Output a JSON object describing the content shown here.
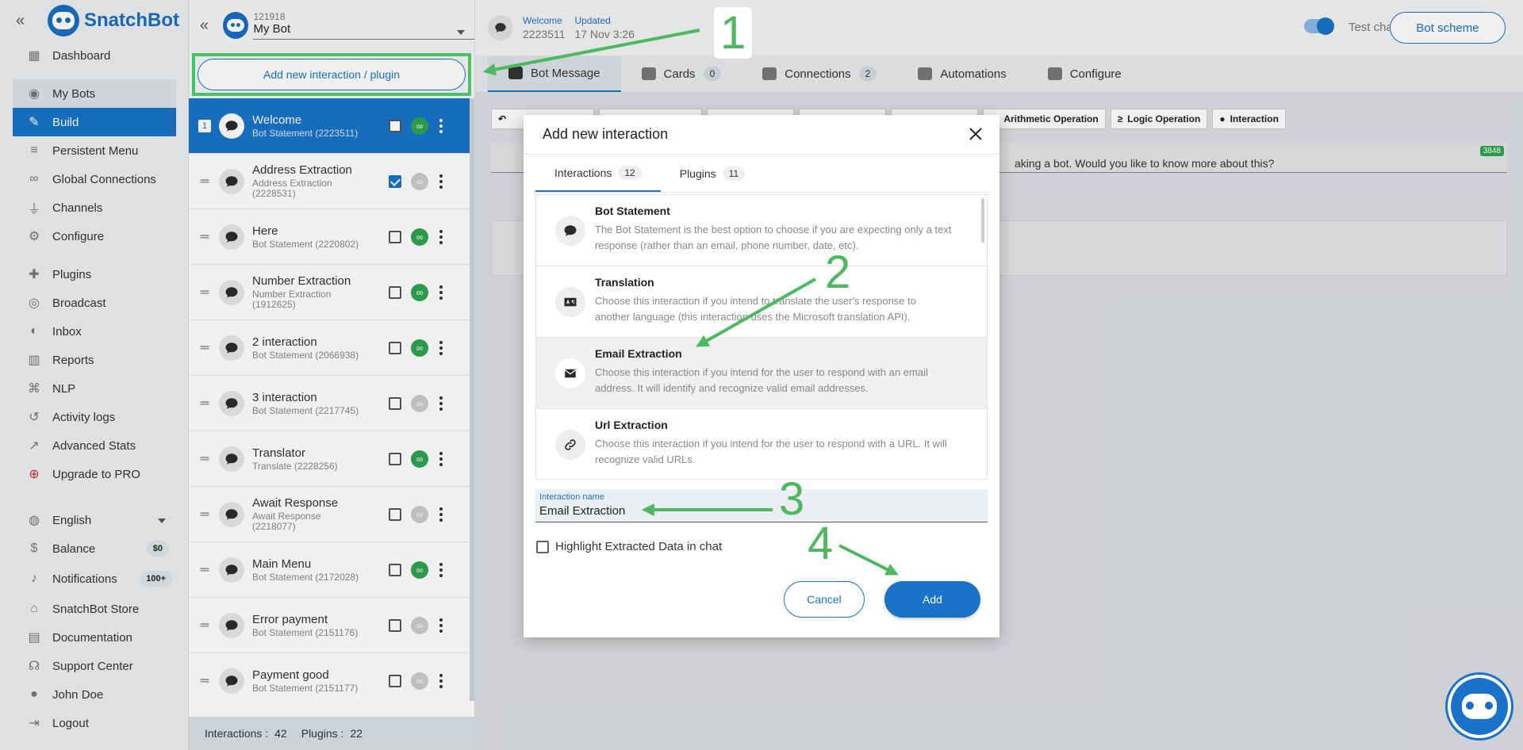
{
  "app": {
    "name": "SnatchBot"
  },
  "sidebar": {
    "items": [
      {
        "label": "Dashboard",
        "icon": "dashboard-icon"
      },
      {
        "label": "My Bots",
        "icon": "robot-icon"
      },
      {
        "label": "Build",
        "icon": "edit-icon"
      },
      {
        "label": "Persistent Menu",
        "icon": "menu-icon"
      },
      {
        "label": "Global Connections",
        "icon": "link-icon"
      },
      {
        "label": "Channels",
        "icon": "plug-icon"
      },
      {
        "label": "Configure",
        "icon": "gear-icon"
      },
      {
        "label": "Plugins",
        "icon": "puzzle-icon"
      },
      {
        "label": "Broadcast",
        "icon": "broadcast-icon"
      },
      {
        "label": "Inbox",
        "icon": "chat-icon"
      },
      {
        "label": "Reports",
        "icon": "bar-chart-icon"
      },
      {
        "label": "NLP",
        "icon": "nlp-icon"
      },
      {
        "label": "Activity logs",
        "icon": "history-icon"
      },
      {
        "label": "Advanced Stats",
        "icon": "line-chart-icon"
      },
      {
        "label": "Upgrade to PRO",
        "icon": "plus-circle-icon"
      }
    ],
    "language": "English",
    "balance_label": "Balance",
    "balance_value": "$0",
    "notifications_label": "Notifications",
    "notifications_count": "100+",
    "store": "SnatchBot Store",
    "documentation": "Documentation",
    "support": "Support Center",
    "user": "John Doe",
    "logout": "Logout"
  },
  "bot": {
    "id": "121918",
    "name": "My Bot"
  },
  "interactions_panel": {
    "add_button": "Add new interaction / plugin",
    "rows": [
      {
        "index": "1",
        "title": "Welcome",
        "sub": "Bot Statement (2223511)",
        "linked": true,
        "checked": false
      },
      {
        "title": "Address Extraction",
        "sub": "Address Extraction (2228531)",
        "linked": false,
        "checked": true
      },
      {
        "title": "Here",
        "sub": "Bot Statement (2220802)",
        "linked": true,
        "checked": false
      },
      {
        "title": "Number Extraction",
        "sub": "Number Extraction (1912625)",
        "linked": true,
        "checked": false
      },
      {
        "title": "2 interaction",
        "sub": "Bot Statement (2066938)",
        "linked": true,
        "checked": false
      },
      {
        "title": "3 interaction",
        "sub": "Bot Statement (2217745)",
        "linked": false,
        "checked": false
      },
      {
        "title": "Translator",
        "sub": "Translate (2228256)",
        "linked": true,
        "checked": false
      },
      {
        "title": "Await Response",
        "sub": "Await Response (2218077)",
        "linked": false,
        "checked": false
      },
      {
        "title": "Main Menu",
        "sub": "Bot Statement (2172028)",
        "linked": true,
        "checked": false
      },
      {
        "title": "Error payment",
        "sub": "Bot Statement (2151176)",
        "linked": false,
        "checked": false
      },
      {
        "title": "Payment good",
        "sub": "Bot Statement (2151177)",
        "linked": false,
        "checked": false
      }
    ],
    "footer_interactions_label": "Interactions :",
    "footer_interactions_count": "42",
    "footer_plugins_label": "Plugins :",
    "footer_plugins_count": "22"
  },
  "main": {
    "welcome_label": "Welcome",
    "welcome_value": "2223511",
    "updated_label": "Updated",
    "updated_value": "17 Nov 3:26",
    "test_chat": "Test chat",
    "bot_scheme": "Bot scheme",
    "tabs": [
      {
        "label": "Bot Message"
      },
      {
        "label": "Cards",
        "count": "0"
      },
      {
        "label": "Connections",
        "count": "2"
      },
      {
        "label": "Automations"
      },
      {
        "label": "Configure"
      }
    ],
    "tools": [
      "Arithmetic Operation",
      "Logic Operation",
      "Interaction"
    ],
    "bot_msg_partial": "aking a bot. Would you like to know more about this?",
    "char_count": "3848"
  },
  "modal": {
    "title": "Add new interaction",
    "tab_interactions": "Interactions",
    "tab_interactions_count": "12",
    "tab_plugins": "Plugins",
    "tab_plugins_count": "11",
    "options": [
      {
        "title": "Bot Statement",
        "desc": "The Bot Statement is the best option to choose if you are expecting only a text response (rather than an email, phone number, date, etc).",
        "icon": "chat-icon"
      },
      {
        "title": "Translation",
        "desc": "Choose this interaction if you intend to translate the user's response to another language (this interaction uses the Microsoft translation API).",
        "icon": "translate-icon"
      },
      {
        "title": "Email Extraction",
        "desc": "Choose this interaction if you intend for the user to respond with an email address. It will identify and recognize valid email addresses.",
        "icon": "envelope-icon"
      },
      {
        "title": "Url Extraction",
        "desc": "Choose this interaction if you intend for the user to respond with a URL. It will recognize valid URLs.",
        "icon": "link-icon"
      }
    ],
    "name_label": "Interaction name",
    "name_value": "Email Extraction",
    "highlight_label": "Highlight Extracted Data in chat",
    "cancel": "Cancel",
    "add": "Add"
  },
  "annotations": {
    "step1": "1",
    "step2": "2",
    "step3": "3",
    "step4": "4",
    "color": "#4cb860"
  }
}
